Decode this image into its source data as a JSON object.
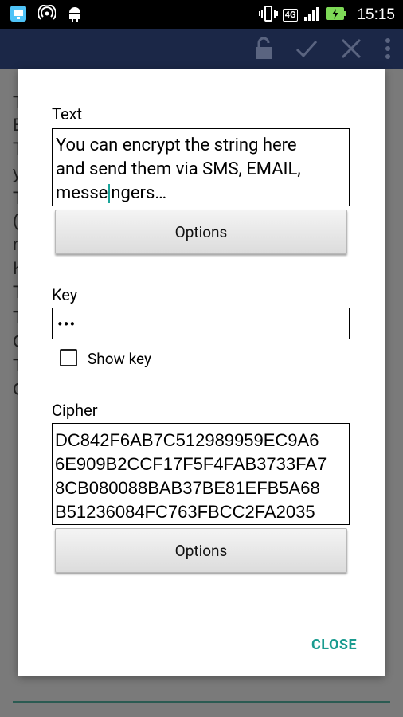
{
  "status_bar": {
    "time": "15:15",
    "network": "4G",
    "icons": [
      "remote-desktop-icon",
      "hotspot-icon",
      "android-icon",
      "vibrate-icon",
      "signal-icon",
      "battery-charging-icon"
    ]
  },
  "toolbar": {
    "icons": [
      "lock-icon",
      "check-icon",
      "close-icon",
      "overflow-menu-icon"
    ]
  },
  "background": {
    "lines": [
      "T",
      "E",
      "T",
      "y",
      "T",
      "(",
      "n",
      "K",
      "T",
      "T",
      "G",
      "T",
      "G"
    ]
  },
  "dialog": {
    "text_label": "Text",
    "text_value": [
      "You can encrypt the string here",
      "and send them via SMS, EMAIL,",
      "messe",
      "ngers…"
    ],
    "options_button_1": "Options",
    "key_label": "Key",
    "key_value": "•••",
    "show_key_label": "Show key",
    "show_key_checked": false,
    "cipher_label": "Cipher",
    "cipher_value": [
      "DC842F6AB7C512989959EC9A6",
      "6E909B2CCF17F5F4FAB3733FA7",
      "8CB080088BAB37BE81EFB5A68",
      "B51236084FC763FBCC2FA2035"
    ],
    "options_button_2": "Options",
    "close_button": "CLOSE"
  },
  "colors": {
    "toolbar": "#1b2747",
    "accent": "#1a9b8f",
    "dim_background": "#7a7a7a"
  }
}
